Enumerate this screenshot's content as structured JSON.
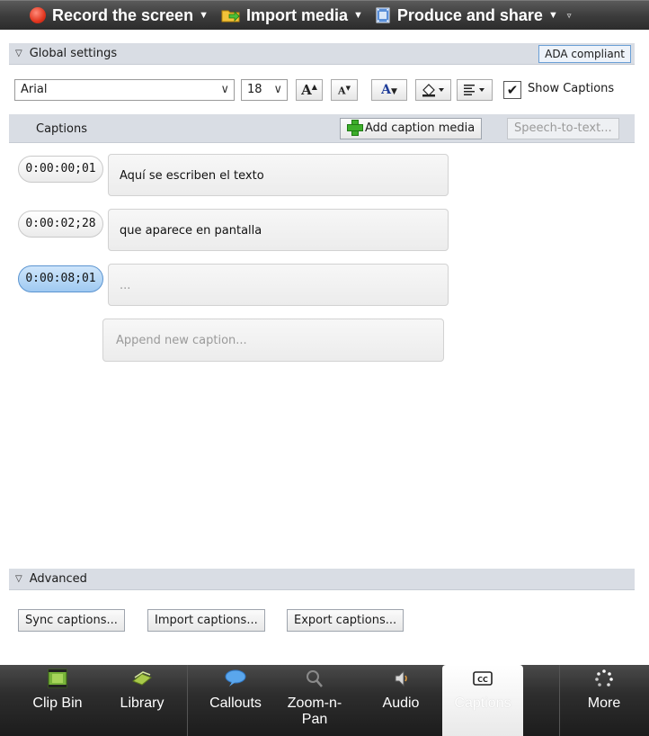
{
  "toolbar": {
    "record_label": "Record the screen",
    "import_label": "Import media",
    "produce_label": "Produce and share"
  },
  "global_settings": {
    "title": "Global settings",
    "ada_label": "ADA compliant",
    "font": "Arial",
    "size": "18",
    "show_captions_label": "Show Captions",
    "show_captions_checked": "✔"
  },
  "captions": {
    "title": "Captions",
    "add_media_label": "Add caption media",
    "speech_label": "Speech-to-text...",
    "items": [
      {
        "time": "0:00:00;01",
        "text": "Aquí se escriben el texto"
      },
      {
        "time": "0:00:02;28",
        "text": "que aparece en pantalla"
      },
      {
        "time": "0:00:08;01",
        "text": "..."
      }
    ],
    "append_placeholder": "Append new caption..."
  },
  "advanced": {
    "title": "Advanced",
    "sync_label": "Sync captions...",
    "import_label": "Import captions...",
    "export_label": "Export captions..."
  },
  "dock": {
    "tabs": [
      {
        "label": "Clip Bin",
        "icon": "film-strip-icon"
      },
      {
        "label": "Library",
        "icon": "library-icon"
      },
      {
        "label": "Callouts",
        "icon": "speech-bubble-icon"
      },
      {
        "label": "Zoom-n-Pan",
        "icon": "magnifier-icon"
      },
      {
        "label": "Audio",
        "icon": "speaker-icon"
      },
      {
        "label": "Captions",
        "icon": "cc-icon"
      },
      {
        "label": "More",
        "icon": "spinner-dots-icon"
      }
    ],
    "active": "Captions"
  },
  "colors": {
    "toolbar_bg": "#3b3b3b",
    "section_bg": "#d9dde4",
    "active_pill": "#9fc9f1",
    "record_red": "#e2361f",
    "add_green": "#3dae2b"
  }
}
